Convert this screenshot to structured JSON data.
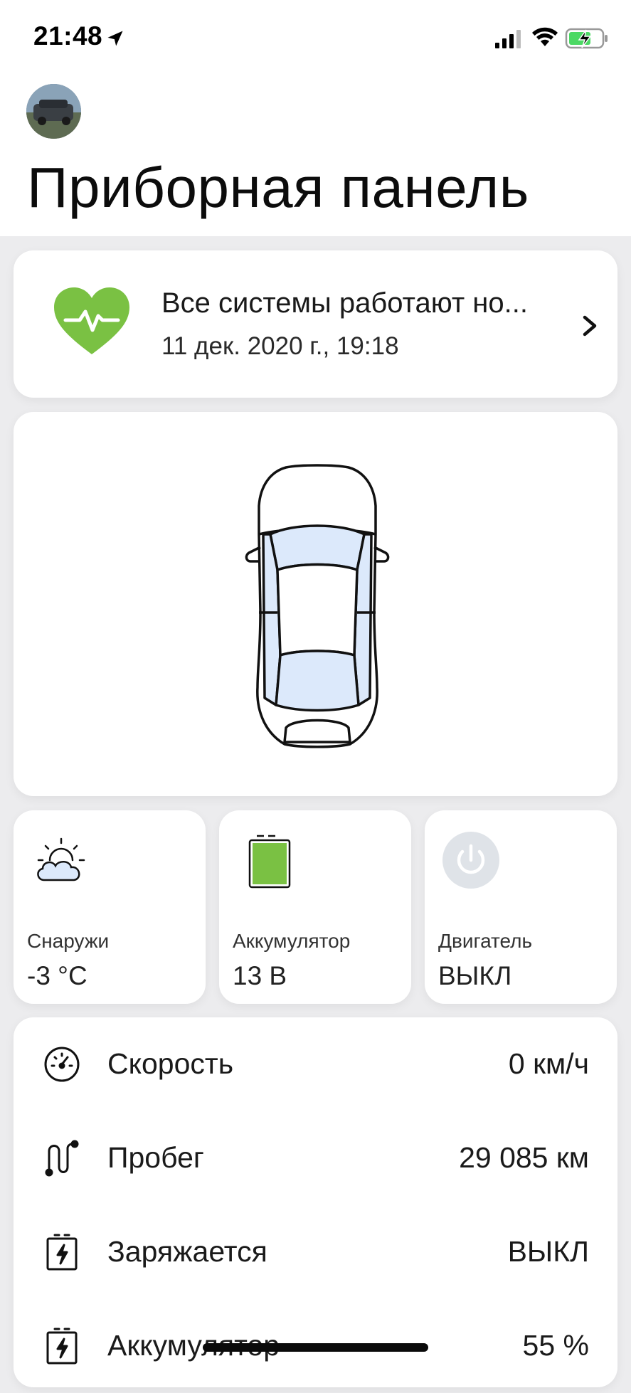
{
  "status_bar": {
    "time": "21:48"
  },
  "header": {
    "title": "Приборная панель"
  },
  "health": {
    "title": "Все системы работают но...",
    "date": "11 дек. 2020 г., 19:18",
    "status_color": "#7ac143"
  },
  "tiles": [
    {
      "label": "Снаружи",
      "value": "-3 °C",
      "icon": "weather-partly-cloudy-icon"
    },
    {
      "label": "Аккумулятор",
      "value": "13 В",
      "icon": "battery-icon"
    },
    {
      "label": "Двигатель",
      "value": "ВЫКЛ",
      "icon": "power-icon"
    }
  ],
  "stats": [
    {
      "label": "Скорость",
      "value": "0 км/ч",
      "icon": "speedometer-icon"
    },
    {
      "label": "Пробег",
      "value": "29 085 км",
      "icon": "route-icon"
    },
    {
      "label": "Заряжается",
      "value": "ВЫКЛ",
      "icon": "charging-icon"
    },
    {
      "label": "Аккумулятор",
      "value": "55 %",
      "icon": "battery-level-icon"
    }
  ],
  "colors": {
    "accent_green": "#7ac143",
    "background": "#ececee",
    "card": "#ffffff",
    "window_tint": "#dce9fb"
  }
}
